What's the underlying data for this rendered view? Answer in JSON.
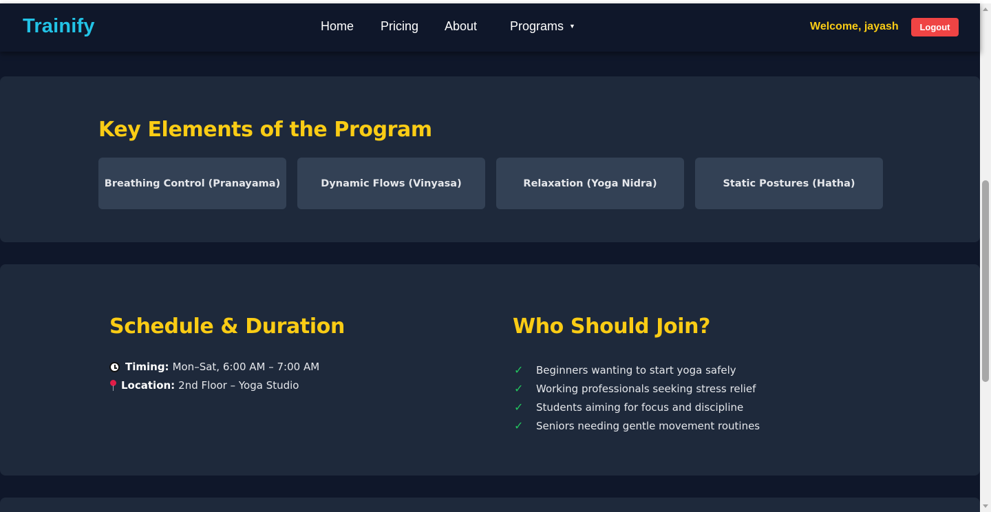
{
  "navbar": {
    "brand": "Trainify",
    "links": {
      "home": "Home",
      "pricing": "Pricing",
      "about": "About",
      "programs": "Programs"
    },
    "welcome": "Welcome, jayash",
    "logout": "Logout"
  },
  "key_elements": {
    "title": "Key Elements of the Program",
    "items": [
      "Breathing Control (Pranayama)",
      "Dynamic Flows (Vinyasa)",
      "Relaxation (Yoga Nidra)",
      "Static Postures (Hatha)"
    ]
  },
  "schedule": {
    "title": "Schedule & Duration",
    "timing_label": "Timing:",
    "timing_value": "Mon–Sat, 6:00 AM – 7:00 AM",
    "location_label": "Location:",
    "location_value": "2nd Floor – Yoga Studio"
  },
  "who": {
    "title": "Who Should Join?",
    "items": [
      "Beginners wanting to start yoga safely",
      "Working professionals seeking stress relief",
      "Students aiming for focus and discipline",
      "Seniors needing gentle movement routines"
    ]
  },
  "icons": {
    "caret": "chevron-down-icon",
    "timing": "clock-icon",
    "location": "pin-icon",
    "check": "check-icon"
  },
  "colors": {
    "background": "#0f172a",
    "section": "#1e293b",
    "card": "#334155",
    "heading": "#facc15",
    "brand": "#22c3e6",
    "logout": "#ef4444",
    "check": "#22c55e"
  }
}
